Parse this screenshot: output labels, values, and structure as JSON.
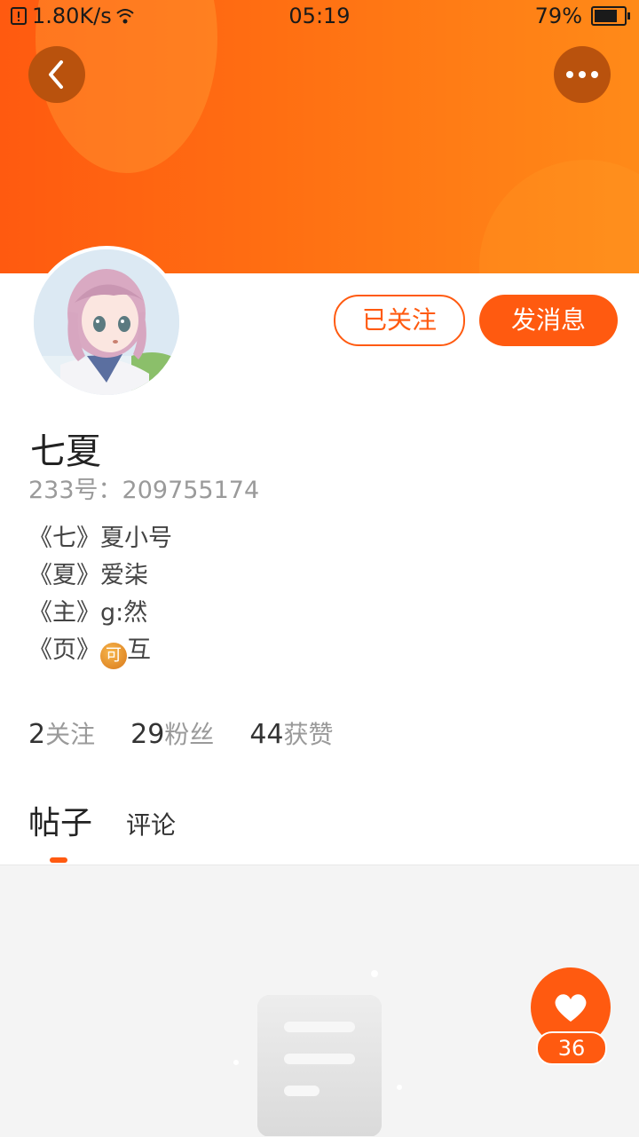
{
  "status_bar": {
    "network_speed": "1.80K/s",
    "time": "05:19",
    "battery_percent": "79%",
    "battery_level": 0.79
  },
  "header": {
    "back_icon": "chevron-left-icon",
    "more_icon": "more-horizontal-icon",
    "accent_color": "#ff5a10"
  },
  "profile": {
    "name": "七夏",
    "uid": "233号：209755174",
    "bio": [
      "《七》夏小号",
      "《夏》爱柒",
      "《主》g:然"
    ],
    "bio_last_prefix": "《页》",
    "bio_last_badge": "可",
    "bio_last_suffix": "互"
  },
  "actions": {
    "following_label": "已关注",
    "message_label": "发消息"
  },
  "stats": [
    {
      "num": "2",
      "label": "关注"
    },
    {
      "num": "29",
      "label": "粉丝"
    },
    {
      "num": "44",
      "label": "获赞"
    }
  ],
  "tabs": {
    "posts": "帖子",
    "comments": "评论"
  },
  "like": {
    "count": "36",
    "icon": "heart-icon"
  }
}
